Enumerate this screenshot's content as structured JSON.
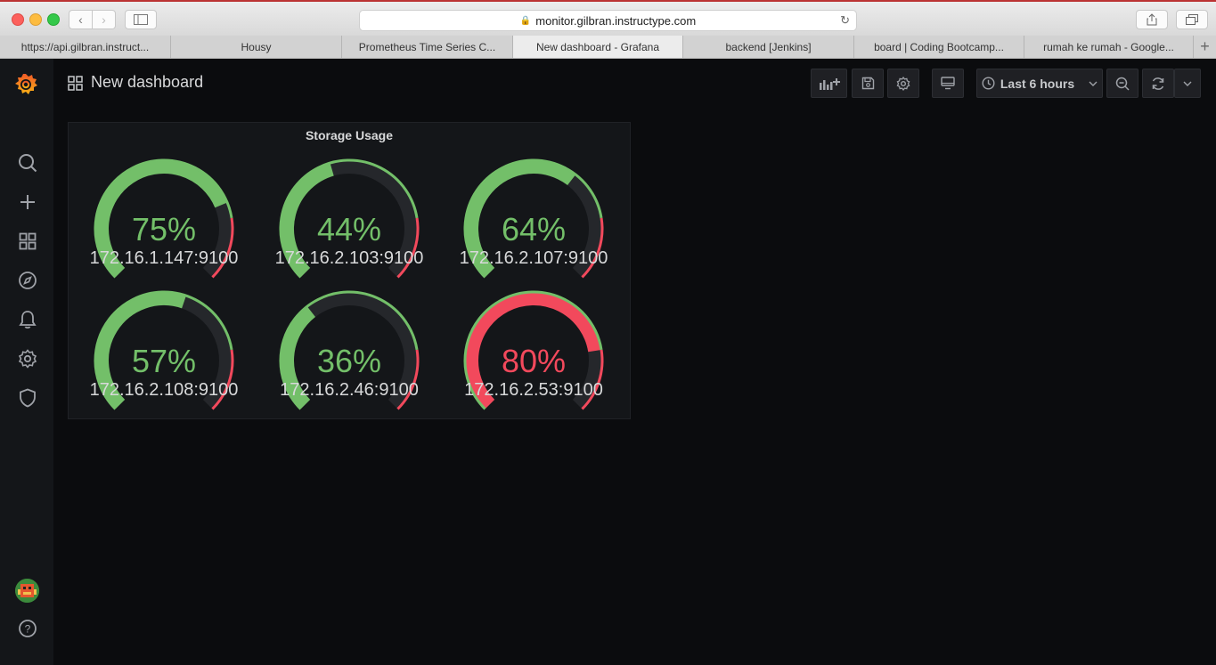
{
  "browser": {
    "url": "monitor.gilbran.instructype.com",
    "tabs": [
      {
        "title": "https://api.gilbran.instruct...",
        "active": false
      },
      {
        "title": "Housy",
        "active": false
      },
      {
        "title": "Prometheus Time Series C...",
        "active": false
      },
      {
        "title": "New dashboard - Grafana",
        "active": true
      },
      {
        "title": "backend [Jenkins]",
        "active": false
      },
      {
        "title": "board | Coding Bootcamp...",
        "active": false
      },
      {
        "title": "rumah ke rumah - Google...",
        "active": false
      }
    ],
    "new_tab_label": "+"
  },
  "sidemenu": {
    "items": [
      "search-icon",
      "plus-icon",
      "dashboards-icon",
      "explore-icon",
      "alerting-icon",
      "configuration-icon",
      "shield-icon"
    ],
    "help_label": "?"
  },
  "header": {
    "title": "New dashboard",
    "time_range": "Last 6 hours"
  },
  "panel": {
    "title": "Storage Usage",
    "gauges": [
      {
        "value": 75,
        "display": "75%",
        "label": "172.16.1.147:9100",
        "color": "#73bf69"
      },
      {
        "value": 44,
        "display": "44%",
        "label": "172.16.2.103:9100",
        "color": "#73bf69"
      },
      {
        "value": 64,
        "display": "64%",
        "label": "172.16.2.107:9100",
        "color": "#73bf69"
      },
      {
        "value": 57,
        "display": "57%",
        "label": "172.16.2.108:9100",
        "color": "#73bf69"
      },
      {
        "value": 36,
        "display": "36%",
        "label": "172.16.2.46:9100",
        "color": "#73bf69"
      },
      {
        "value": 80,
        "display": "80%",
        "label": "172.16.2.53:9100",
        "color": "#f2495c"
      }
    ],
    "threshold": 80,
    "colors": {
      "ok": "#73bf69",
      "critical": "#f2495c",
      "track": "#25272b"
    }
  }
}
